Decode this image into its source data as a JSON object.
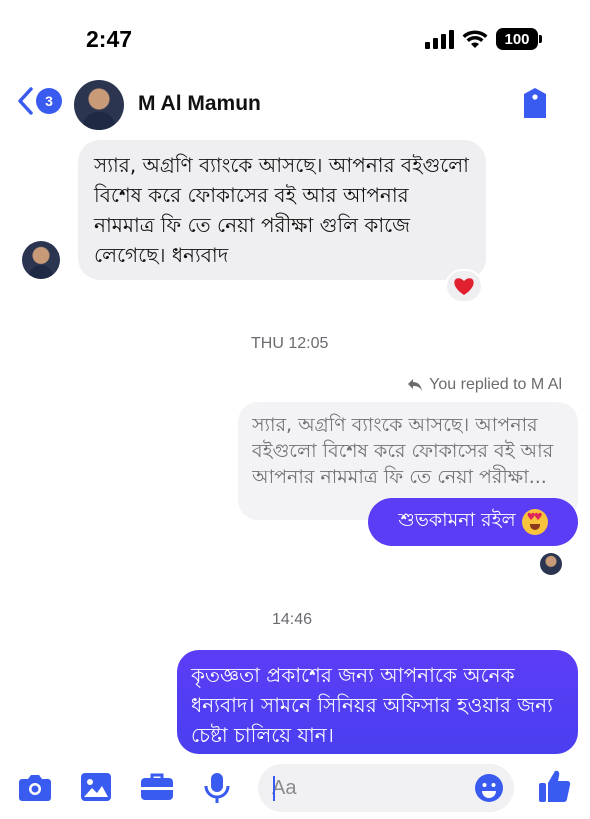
{
  "status_bar": {
    "time": "2:47",
    "battery": "100"
  },
  "header": {
    "back_badge": "3",
    "contact_name": "M Al Mamun"
  },
  "messages": {
    "incoming_text": "স্যার, অগ্রণি ব্যাংকে আসছে। আপনার বইগুলো বিশেষ করে ফোকাসের বই আর আপনার নামমাত্র ফি তে নেয়া পরীক্ষা গুলি কাজে লেগেছে। ধন্যবাদ",
    "reaction": "❤️",
    "timestamp_1": "THU 12:05",
    "replied_label": "You replied to M Al",
    "quoted_text": "স্যার, অগ্রণি ব্যাংকে আসছে। আপনার বইগুলো বিশেষ করে ফোকাসের বই আর আপনার নামমাত্র ফি তে নেয়া পরীক্ষা...",
    "reply_text": "শুভকামনা রইল",
    "timestamp_2": "14:46",
    "outgoing_text": "কৃতজ্ঞতা প্রকাশের জন্য আপনাকে অনেক ধন্যবাদ। সামনে সিনিয়র অফিসার হওয়ার জন্য চেষ্টা চালিয়ে যান।"
  },
  "composer": {
    "placeholder": "Aa",
    "icons": [
      "camera-icon",
      "image-icon",
      "briefcase-icon",
      "microphone-icon",
      "emoji-icon",
      "thumbs-up-icon"
    ]
  },
  "colors": {
    "accent": "#3a5bf0",
    "bubble_out": "#5b3df5",
    "bubble_in": "#efeff1"
  }
}
